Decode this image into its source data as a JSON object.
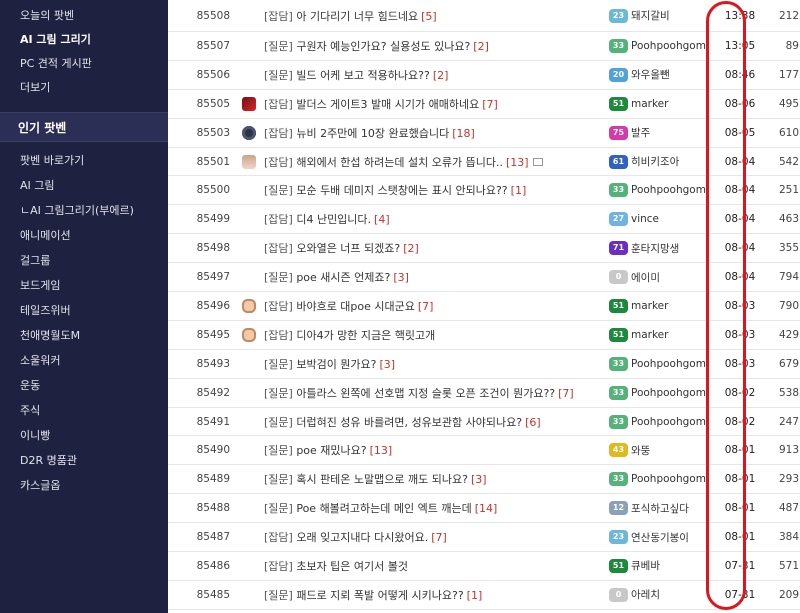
{
  "sidebar": {
    "top_items": [
      {
        "label": "오늘의 팟벤",
        "bold": false
      },
      {
        "label": "AI 그림 그리기",
        "bold": true
      },
      {
        "label": "PC 견적 게시판",
        "bold": false
      },
      {
        "label": "더보기",
        "bold": false
      }
    ],
    "section_title": "인기 팟벤",
    "popular_items": [
      "팟벤 바로가기",
      "AI 그림",
      "ㄴAI 그림그리기(부에르)",
      "애니메이션",
      "걸그룹",
      "보드게임",
      "테일즈위버",
      "천애명월도M",
      "소울워커",
      "운동",
      "주식",
      "이니빵",
      "D2R 명품관",
      "카스글옵"
    ]
  },
  "posts": [
    {
      "num": "85508",
      "icon": "",
      "cat": "[잡담]",
      "title": "아 기다리기 너무 힘드네요",
      "comments": "[5]",
      "img": false,
      "lvl": "23",
      "lvl_color": "#6cb8d6",
      "author": "돼지갈비",
      "date": "13:38",
      "views": "212"
    },
    {
      "num": "85507",
      "icon": "",
      "cat": "[질문]",
      "title": "구원자 예능인가요? 실용성도 있나요?",
      "comments": "[2]",
      "img": false,
      "lvl": "33",
      "lvl_color": "#55b27a",
      "author": "Poohpoohgom",
      "date": "13:05",
      "views": "89"
    },
    {
      "num": "85506",
      "icon": "",
      "cat": "[질문]",
      "title": "빌드 어케 보고 적용하나요??",
      "comments": "[2]",
      "img": false,
      "lvl": "20",
      "lvl_color": "#4fa3d9",
      "author": "와우올뺀",
      "date": "08:46",
      "views": "177"
    },
    {
      "num": "85505",
      "icon": "red-game",
      "cat": "[잡담]",
      "title": "발더스 게이트3 발매 시기가 애매하네요",
      "comments": "[7]",
      "img": false,
      "lvl": "51",
      "lvl_color": "#1b8a3a",
      "author": "marker",
      "date": "08-06",
      "views": "495"
    },
    {
      "num": "85503",
      "icon": "dark-circle",
      "cat": "[잡담]",
      "title": "뉴비 2주만에 10장 완료했습니다",
      "comments": "[18]",
      "img": false,
      "lvl": "75",
      "lvl_color": "#d63aa8",
      "author": "발주",
      "date": "08-05",
      "views": "610"
    },
    {
      "num": "85501",
      "icon": "anime-girl",
      "cat": "[잡담]",
      "title": "해외에서 한섭 하려는데 설치 오류가 뜹니다..",
      "comments": "[13]",
      "img": true,
      "lvl": "61",
      "lvl_color": "#2f62c4",
      "author": "히비키조아",
      "date": "08-04",
      "views": "542"
    },
    {
      "num": "85500",
      "icon": "",
      "cat": "[질문]",
      "title": "모순 두배 데미지 스탯창에는 표시 안되나요??",
      "comments": "[1]",
      "img": false,
      "lvl": "33",
      "lvl_color": "#55b27a",
      "author": "Poohpoohgom",
      "date": "08-04",
      "views": "251"
    },
    {
      "num": "85499",
      "icon": "",
      "cat": "[잡담]",
      "title": "디4 난민입니다.",
      "comments": "[4]",
      "img": false,
      "lvl": "27",
      "lvl_color": "#6fb4e0",
      "author": "vince",
      "date": "08-04",
      "views": "463"
    },
    {
      "num": "85498",
      "icon": "",
      "cat": "[잡담]",
      "title": "오와열은 너프 되겠죠?",
      "comments": "[2]",
      "img": false,
      "lvl": "71",
      "lvl_color": "#6a2fc0",
      "author": "훈타지망생",
      "date": "08-04",
      "views": "355"
    },
    {
      "num": "85497",
      "icon": "",
      "cat": "[질문]",
      "title": "poe 새시즌 언제죠?",
      "comments": "[3]",
      "img": false,
      "lvl": "0",
      "lvl_color": "#c8c8c8",
      "author": "에이미",
      "date": "08-04",
      "views": "794"
    },
    {
      "num": "85496",
      "icon": "pig",
      "cat": "[잡담]",
      "title": "바야흐로 대poe 시대군요",
      "comments": "[7]",
      "img": false,
      "lvl": "51",
      "lvl_color": "#1b8a3a",
      "author": "marker",
      "date": "08-03",
      "views": "790"
    },
    {
      "num": "85495",
      "icon": "pig",
      "cat": "[잡담]",
      "title": "디아4가 망한 지금은 핵릿고개",
      "comments": "",
      "img": false,
      "lvl": "51",
      "lvl_color": "#1b8a3a",
      "author": "marker",
      "date": "08-03",
      "views": "429"
    },
    {
      "num": "85493",
      "icon": "",
      "cat": "[질문]",
      "title": "보박검이 뭔가요?",
      "comments": "[3]",
      "img": false,
      "lvl": "33",
      "lvl_color": "#55b27a",
      "author": "Poohpoohgom",
      "date": "08-03",
      "views": "679"
    },
    {
      "num": "85492",
      "icon": "",
      "cat": "[질문]",
      "title": "아틀라스 왼쪽에 선호맵 지정 슬롯 오픈 조건이 뭔가요??",
      "comments": "[7]",
      "img": false,
      "lvl": "33",
      "lvl_color": "#55b27a",
      "author": "Poohpoohgom",
      "date": "08-02",
      "views": "538"
    },
    {
      "num": "85491",
      "icon": "",
      "cat": "[질문]",
      "title": "더럽혀진 성유 바를려면, 성유보관함 사야되나요?",
      "comments": "[6]",
      "img": false,
      "lvl": "33",
      "lvl_color": "#55b27a",
      "author": "Poohpoohgom",
      "date": "08-02",
      "views": "247"
    },
    {
      "num": "85490",
      "icon": "",
      "cat": "[질문]",
      "title": "poe 재밌나요?",
      "comments": "[13]",
      "img": false,
      "lvl": "43",
      "lvl_color": "#e2b91c",
      "author": "와뚱",
      "date": "08-01",
      "views": "913"
    },
    {
      "num": "85489",
      "icon": "",
      "cat": "[질문]",
      "title": "혹시 판테온 노말맵으로 깨도 되나요?",
      "comments": "[3]",
      "img": false,
      "lvl": "33",
      "lvl_color": "#55b27a",
      "author": "Poohpoohgom",
      "date": "08-01",
      "views": "293"
    },
    {
      "num": "85488",
      "icon": "",
      "cat": "[질문]",
      "title": "Poe 해볼려고하는데 메인 엑트 깨는데",
      "comments": "[14]",
      "img": false,
      "lvl": "12",
      "lvl_color": "#8aa1b8",
      "author": "포식하고싶다",
      "date": "08-01",
      "views": "487"
    },
    {
      "num": "85487",
      "icon": "",
      "cat": "[잡담]",
      "title": "오래 잊고지내다 다시왔어요.",
      "comments": "[7]",
      "img": false,
      "lvl": "23",
      "lvl_color": "#6cb8d6",
      "author": "연산동기봉이",
      "date": "08-01",
      "views": "384"
    },
    {
      "num": "85486",
      "icon": "",
      "cat": "[잡담]",
      "title": "초보자 팁은 여기서 볼것",
      "comments": "",
      "img": false,
      "lvl": "51",
      "lvl_color": "#1b8a3a",
      "author": "큐베바",
      "date": "07-31",
      "views": "571"
    },
    {
      "num": "85485",
      "icon": "",
      "cat": "[질문]",
      "title": "패드로 지뢰 폭발 어떻게 시키나요??",
      "comments": "[1]",
      "img": false,
      "lvl": "0",
      "lvl_color": "#c8c8c8",
      "author": "아레치",
      "date": "07-31",
      "views": "209"
    }
  ]
}
